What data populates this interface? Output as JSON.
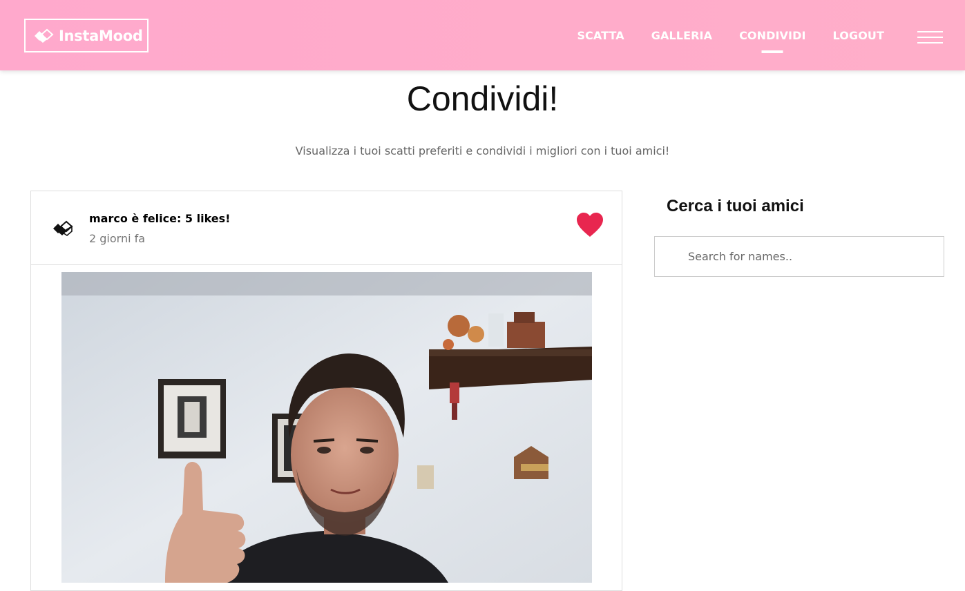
{
  "app": {
    "name": "InstaMood"
  },
  "nav": {
    "items": [
      {
        "label": "SCATTA"
      },
      {
        "label": "GALLERIA"
      },
      {
        "label": "CONDIVIDI",
        "active": true
      },
      {
        "label": "LOGOUT"
      }
    ],
    "menu_icon": "hamburger-icon"
  },
  "page": {
    "title": "Condividi!",
    "subtitle": "Visualizza i tuoi scatti preferiti e condividi i migliori con i tuoi amici!"
  },
  "post": {
    "title": "marco è felice: 5 likes!",
    "time": "2 giorni fa",
    "like_icon": "heart-icon",
    "heart_color": "#e8264f",
    "photo": "selfie-photo"
  },
  "sidebar": {
    "title": "Cerca i tuoi amici",
    "search_placeholder": "Search for names.."
  },
  "colors": {
    "navbar": "#ffaccb",
    "text_muted": "#666666"
  }
}
